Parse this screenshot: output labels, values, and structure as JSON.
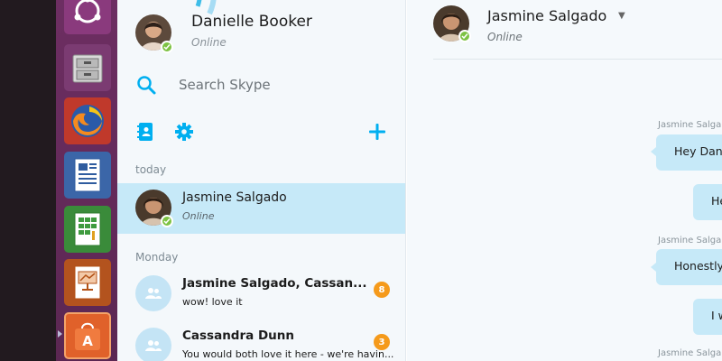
{
  "me": {
    "name": "Danielle Booker",
    "status": "Online"
  },
  "search": {
    "placeholder": "Search Skype"
  },
  "sections": {
    "today": "today",
    "monday": "Monday"
  },
  "conversations": [
    {
      "name": "Jasmine Salgado",
      "sub": "Online"
    },
    {
      "name": "Jasmine Salgado, Cassan...",
      "sub": "wow! love it",
      "badge": "8"
    },
    {
      "name": "Cassandra Dunn",
      "sub": "You would both love it here - we're havin...",
      "badge": "3"
    }
  ],
  "chat": {
    "name": "Jasmine Salgado",
    "status": "Online",
    "messages": [
      {
        "sender": "Jasmine Salga",
        "text": "Hey Dani"
      },
      {
        "sender": "",
        "text": "He"
      },
      {
        "sender": "Jasmine Salga",
        "text": "Honestly,"
      },
      {
        "sender": "",
        "text": "I w"
      },
      {
        "sender": "Jasmine Salga",
        "text": ""
      }
    ]
  },
  "icons": {
    "launcher": [
      "ubuntu-dash-icon",
      "files-icon",
      "firefox-icon",
      "writer-icon",
      "calc-icon",
      "impress-icon",
      "software-center-icon"
    ],
    "tools": [
      "contacts-icon",
      "settings-gear-icon",
      "add-plus-icon"
    ]
  },
  "colors": {
    "accent": "#00aff0",
    "online": "#7dc243",
    "badge": "#f59a1b",
    "selected": "#c6e9f8"
  }
}
